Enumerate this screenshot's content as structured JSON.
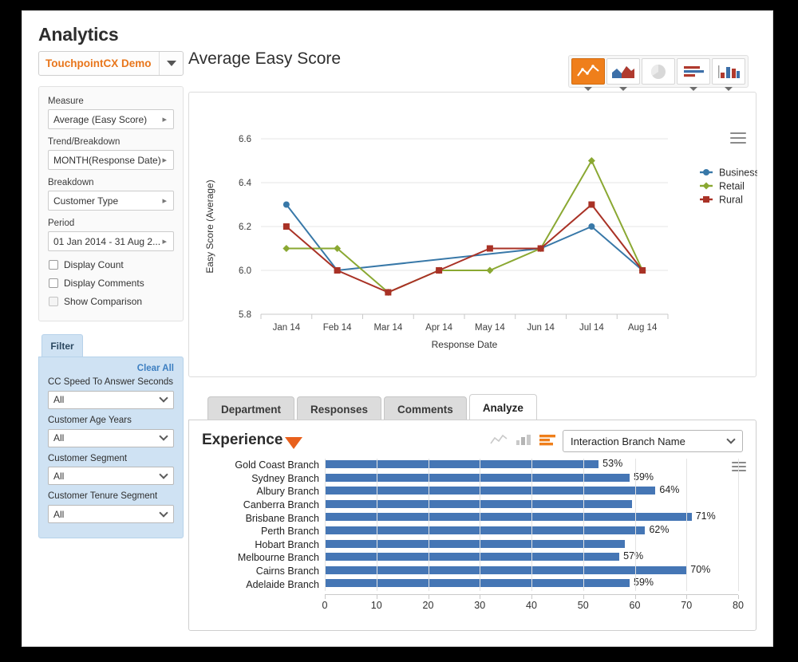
{
  "header": {
    "page_title": "Analytics",
    "account": "TouchpointCX Demo",
    "account_caret_icon": "chevron-down-icon",
    "chart_title": "Average Easy Score"
  },
  "chart_types": [
    {
      "name": "line-chart-type",
      "icon": "line-chart-icon",
      "active": true
    },
    {
      "name": "area-chart-type",
      "icon": "area-chart-icon",
      "active": false
    },
    {
      "name": "pie-chart-type",
      "icon": "pie-chart-icon",
      "active": false
    },
    {
      "name": "bar-chart-type",
      "icon": "horizontal-bar-chart-icon",
      "active": false
    },
    {
      "name": "column-chart-type",
      "icon": "column-chart-icon",
      "active": false
    }
  ],
  "controls": {
    "measure_label": "Measure",
    "measure_value": "Average (Easy Score)",
    "trend_label": "Trend/Breakdown",
    "trend_value": "MONTH(Response Date)",
    "breakdown_label": "Breakdown",
    "breakdown_value": "Customer Type",
    "period_label": "Period",
    "period_value": "01 Jan 2014 - 31 Aug 2...",
    "checkboxes": [
      {
        "label": "Display Count",
        "checked": false
      },
      {
        "label": "Display Comments",
        "checked": false
      },
      {
        "label": "Show Comparison",
        "checked": false
      }
    ]
  },
  "filter": {
    "tab_label": "Filter",
    "clear_all": "Clear All",
    "fields": [
      {
        "label": "CC Speed To Answer Seconds",
        "value": "All"
      },
      {
        "label": "Customer Age Years",
        "value": "All"
      },
      {
        "label": "Customer Segment",
        "value": "All"
      },
      {
        "label": "Customer Tenure Segment",
        "value": "All"
      }
    ]
  },
  "tabs": [
    {
      "label": "Department",
      "active": false
    },
    {
      "label": "Responses",
      "active": false
    },
    {
      "label": "Comments",
      "active": false
    },
    {
      "label": "Analyze",
      "active": true
    }
  ],
  "analyze": {
    "section_title": "Experience",
    "expand_icon": "triangle-down-icon",
    "view_icons": [
      {
        "name": "line-view-icon",
        "active": false
      },
      {
        "name": "column-view-icon",
        "active": false
      },
      {
        "name": "bar-view-icon",
        "active": true
      }
    ],
    "dimension_value": "Interaction Branch Name",
    "dimension_caret_icon": "chevron-down-icon",
    "menu_icon": "hamburger-menu-icon"
  },
  "chart_data": [
    {
      "type": "line",
      "title": "Average Easy Score",
      "xlabel": "Response Date",
      "ylabel": "Easy Score (Average)",
      "x": [
        "Jan 14",
        "Feb 14",
        "Mar 14",
        "Apr 14",
        "May 14",
        "Jun 14",
        "Jul 14",
        "Aug 14"
      ],
      "ylim": [
        5.8,
        6.6
      ],
      "yticks": [
        5.8,
        6.0,
        6.2,
        6.4,
        6.6
      ],
      "grid": true,
      "legend_position": "right",
      "series": [
        {
          "name": "Business",
          "color": "#3878a8",
          "marker": "circle",
          "values": [
            6.3,
            6.0,
            null,
            null,
            null,
            6.1,
            6.2,
            6.0
          ]
        },
        {
          "name": "Retail",
          "color": "#8aa832",
          "marker": "diamond",
          "values": [
            6.1,
            6.1,
            5.9,
            6.0,
            6.0,
            6.1,
            6.5,
            6.0
          ]
        },
        {
          "name": "Rural",
          "color": "#a93226",
          "marker": "square",
          "values": [
            6.2,
            6.0,
            5.9,
            6.0,
            6.1,
            6.1,
            6.3,
            6.0
          ]
        }
      ]
    },
    {
      "type": "bar",
      "orientation": "horizontal",
      "title": "Experience",
      "xlabel": "",
      "ylabel": "",
      "xlim": [
        0,
        80
      ],
      "xticks": [
        0,
        10,
        20,
        30,
        40,
        50,
        60,
        70,
        80
      ],
      "grid": true,
      "bar_color": "#4576b5",
      "categories": [
        "Gold Coast Branch",
        "Sydney Branch",
        "Albury Branch",
        "Canberra Branch",
        "Brisbane Branch",
        "Perth Branch",
        "Hobart Branch",
        "Melbourne Branch",
        "Cairns Branch",
        "Adelaide Branch"
      ],
      "values": [
        53,
        59,
        64,
        59.5,
        71,
        62,
        58,
        57,
        70,
        59
      ],
      "data_labels": [
        "53%",
        "59%",
        "64%",
        "",
        "71%",
        "62%",
        "",
        "57%",
        "70%",
        "59%"
      ]
    }
  ]
}
